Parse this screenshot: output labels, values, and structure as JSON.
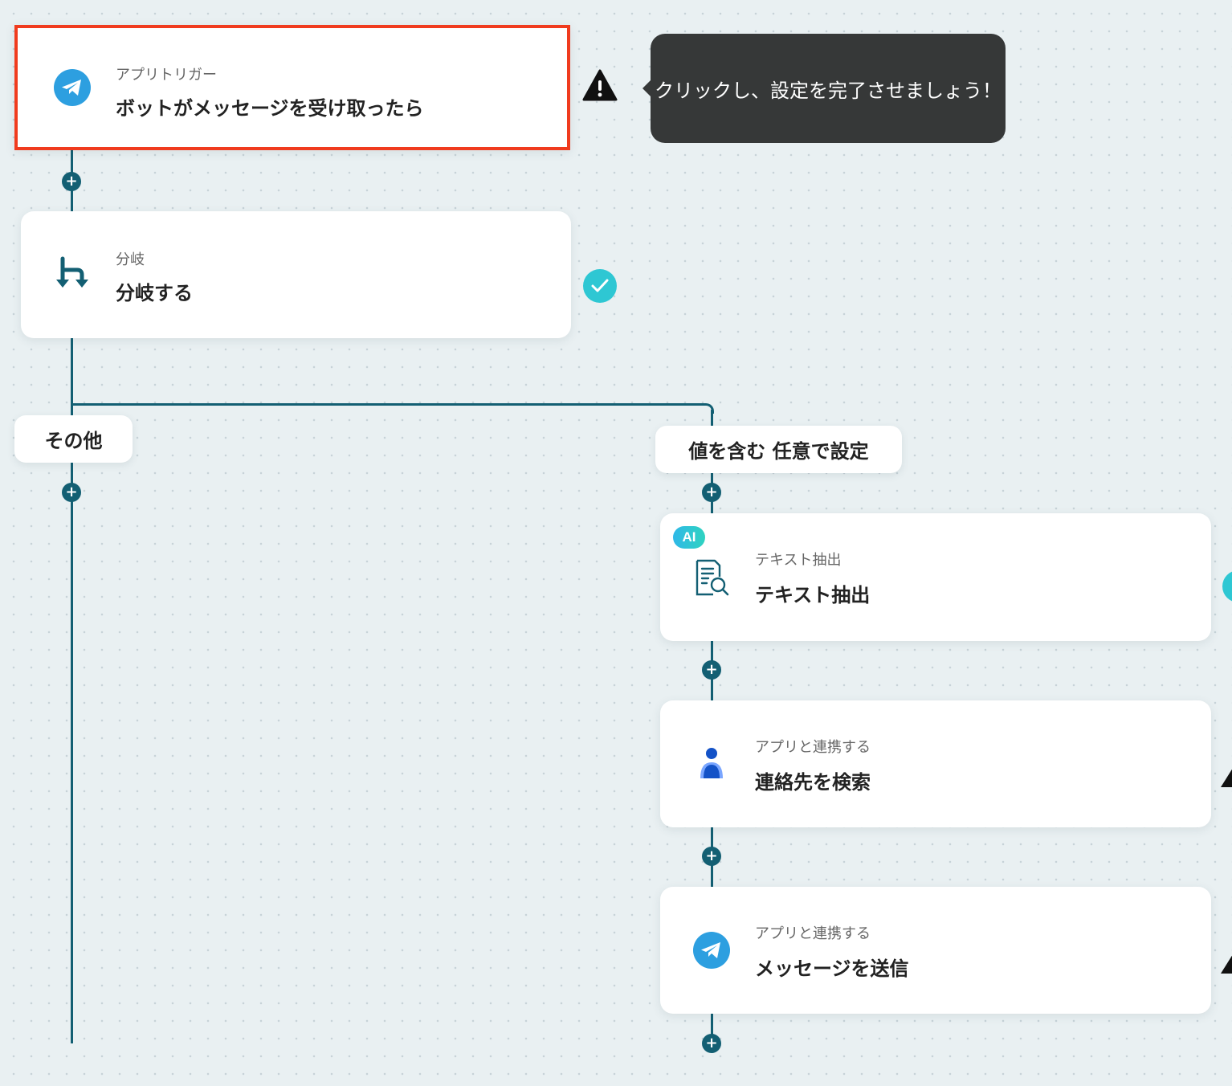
{
  "tooltip": {
    "text": "クリックし、設定を完了させましょう！"
  },
  "nodes": {
    "trigger": {
      "category": "アプリトリガー",
      "title": "ボットがメッセージを受け取ったら",
      "icon": "telegram-icon",
      "status": "warning"
    },
    "branch": {
      "category": "分岐",
      "title": "分岐する",
      "icon": "branch-icon",
      "status": "complete"
    },
    "extract": {
      "badge": "AI",
      "category": "テキスト抽出",
      "title": "テキスト抽出",
      "icon": "document-search-icon",
      "status": "complete"
    },
    "contact": {
      "category": "アプリと連携する",
      "title": "連絡先を検索",
      "icon": "person-icon",
      "status": "warning"
    },
    "send": {
      "category": "アプリと連携する",
      "title": "メッセージを送信",
      "icon": "telegram-icon",
      "status": "warning"
    }
  },
  "branches": {
    "other": "その他",
    "condition": "値を含む 任意で設定"
  },
  "colors": {
    "accent": "#135f73",
    "selected_border": "#f03b1e",
    "check": "#2ec7d3",
    "tooltip_bg": "#363838"
  }
}
